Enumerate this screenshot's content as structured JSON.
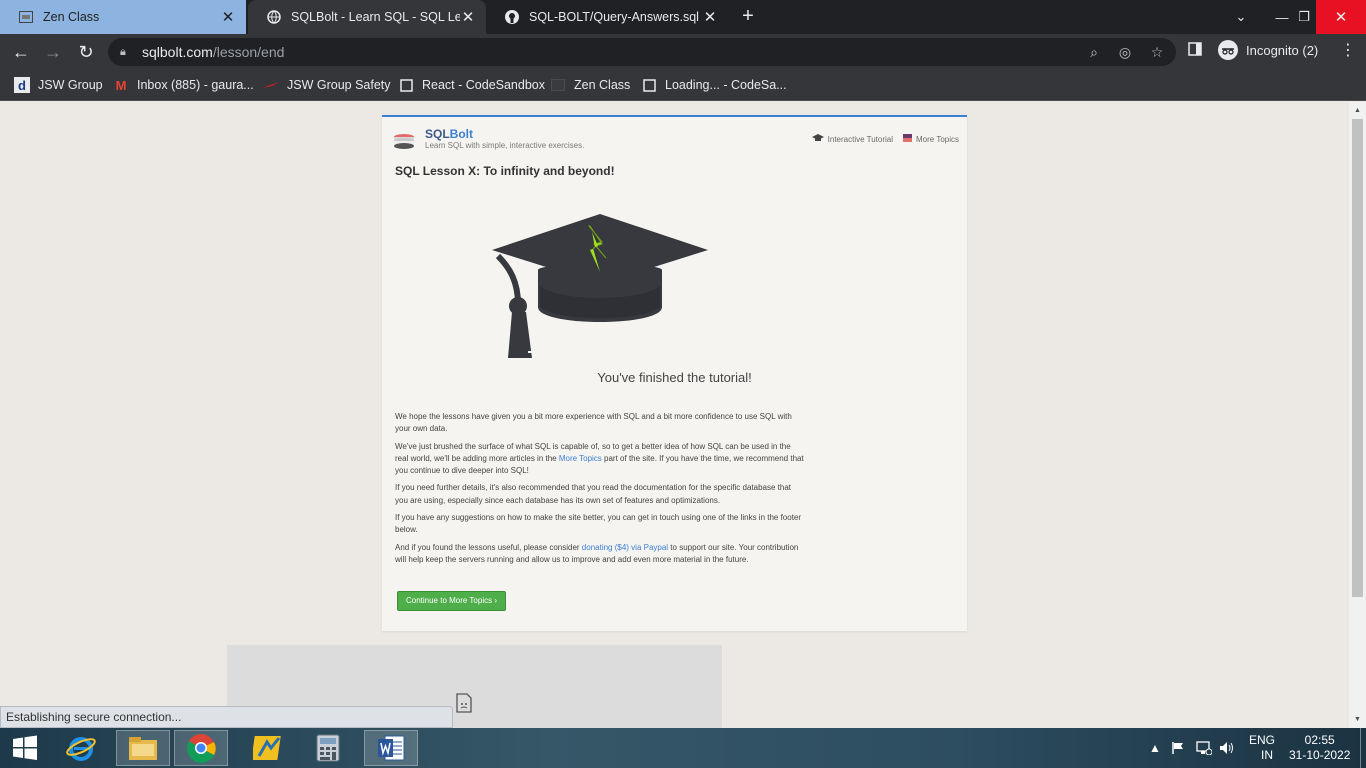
{
  "tabs": [
    {
      "title": "Zen Class",
      "icon": "zen-class-favicon"
    },
    {
      "title": "SQLBolt - Learn SQL - SQL Lesson",
      "icon": "sqlbolt-favicon"
    },
    {
      "title": "SQL-BOLT/Query-Answers.sql at",
      "icon": "github-favicon"
    }
  ],
  "toolbar": {
    "url_host": "sqlbolt.com",
    "url_path": "/lesson/end",
    "incognito_label": "Incognito (2)"
  },
  "bookmarks": [
    {
      "label": "JSW Group",
      "icon": "jsw-d-icon"
    },
    {
      "label": "Inbox (885) - gaura...",
      "icon": "gmail-icon"
    },
    {
      "label": "JSW Group Safety",
      "icon": "jsw-safety-icon"
    },
    {
      "label": "React - CodeSandbox",
      "icon": "codesandbox-icon"
    },
    {
      "label": "Zen Class",
      "icon": "zen-class-icon"
    },
    {
      "label": "Loading... - CodeSa...",
      "icon": "codesandbox-icon"
    }
  ],
  "site": {
    "brand_part1": "SQL",
    "brand_part2": "Bolt",
    "tagline": "Learn SQL with simple, interactive exercises.",
    "nav_tutorial": "Interactive Tutorial",
    "nav_topics": "More Topics"
  },
  "lesson": {
    "title": "SQL Lesson X: To infinity and beyond!",
    "finished": "You've finished the tutorial!",
    "p1": "We hope the lessons have given you a bit more experience with SQL and a bit more confidence to use SQL with your own data.",
    "p2_a": "We've just brushed the surface of what SQL is capable of, so to get a better idea of how SQL can be used in the real world, we'll be adding more articles in the ",
    "p2_link": "More Topics",
    "p2_b": " part of the site. If you have the time, we recommend that you continue to dive deeper into SQL!",
    "p3": "If you need further details, it's also recommended that you read the documentation for the specific database that you are using, especially since each database has its own set of features and optimizations.",
    "p4": "If you have any suggestions on how to make the site better, you can get in touch using one of the links in the footer below.",
    "p5_a": "And if you found the lessons useful, please consider ",
    "p5_link": "donating ($4) via Paypal",
    "p5_b": " to support our site. Your contribution will help keep the servers running and allow us to improve and add even more material in the future.",
    "cta": "Continue to More Topics ›"
  },
  "status": "Establishing secure connection...",
  "tray": {
    "lang1": "ENG",
    "lang2": "IN",
    "time": "02:55",
    "date": "31-10-2022"
  },
  "colors": {
    "accent": "#3d7fd1",
    "cta_green": "#4eae4a",
    "bolt_green": "#9fe020",
    "cap_dark": "#37393e"
  }
}
